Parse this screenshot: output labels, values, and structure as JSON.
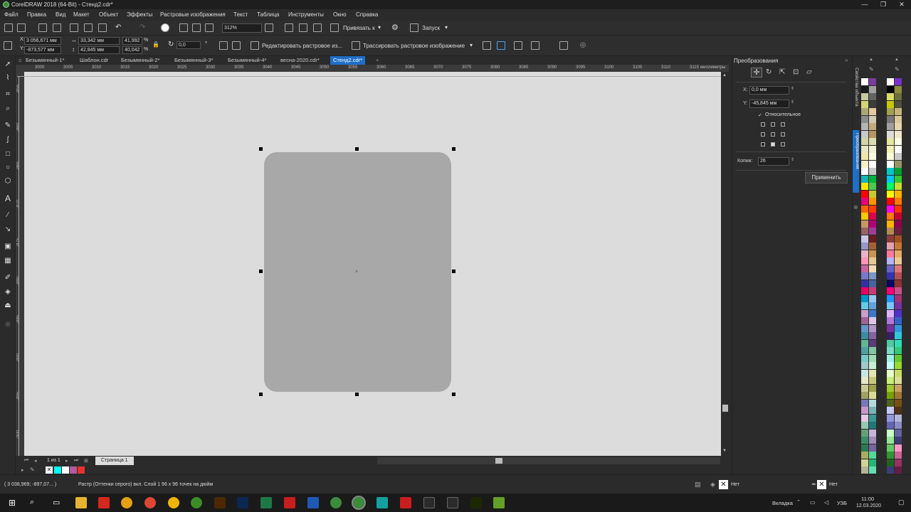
{
  "window": {
    "title": "CorelDRAW 2018 (64-Bit) - Стенд2.cdr*",
    "buttons": [
      "—",
      "❐",
      "✕"
    ]
  },
  "menu": [
    "Файл",
    "Правка",
    "Вид",
    "Макет",
    "Объект",
    "Эффекты",
    "Растровые изображения",
    "Текст",
    "Таблица",
    "Инструменты",
    "Окно",
    "Справка"
  ],
  "toolbar": {
    "zoom": "312%",
    "snap_label": "Привязать к",
    "launch_label": "Запуск"
  },
  "propbar": {
    "x": "3 056,671 мм",
    "y": "-873,577 мм",
    "width": "33,342 мм",
    "height": "42,845 мм",
    "scale_x": "41,992",
    "scale_y": "40,042",
    "pct": "%",
    "rotation": "0,0",
    "edit_bitmap": "Редактировать растровое из...",
    "trace_bitmap": "Трассировать растровое изображение"
  },
  "tabs": [
    "Безымянный-1*",
    "Шаблон.cdr",
    "Безымянный-2*",
    "Безымянный-3*",
    "Безымянный-4*",
    "весна-2020.cdr*",
    "Стенд2.cdr*"
  ],
  "active_tab": 6,
  "ruler": {
    "h_ticks": [
      "3000",
      "3005",
      "3010",
      "3015",
      "3020",
      "3025",
      "3030",
      "3035",
      "3040",
      "3045",
      "3050",
      "3055",
      "3060",
      "3065",
      "3070",
      "3075",
      "3080",
      "3085",
      "3090",
      "3095",
      "3100",
      "3105",
      "3110",
      "3115"
    ],
    "unit": "миллиметры",
    "v_ticks": [
      "-855",
      "-860",
      "-865",
      "-870",
      "-875",
      "-880",
      "-885",
      "-890",
      "-895",
      "-900"
    ]
  },
  "page_nav": {
    "counter": "1 из 1",
    "page_tab": "Страница 1"
  },
  "status": {
    "coords": "( 3 038,969; -897,07... )",
    "info": "Растр (Оттенки серого) вкл. Слой 1 96 x 96 точек на дюйм",
    "fill_none": "Нет",
    "outline_none": "Нет"
  },
  "panel": {
    "title": "Преобразования",
    "x_label": "X:",
    "x_value": "0,0 мм",
    "y_label": "Y:",
    "y_value": "-45,845 мм",
    "relative_label": "Относительное",
    "copies_label": "Копии:",
    "copies_value": "26",
    "apply_label": "Применить",
    "side_tabs": [
      "Свойства объекта",
      "Преобразования"
    ]
  },
  "taskbar": {
    "lang_label": "Вкладка",
    "layout": "УЗБ",
    "time": "11:00",
    "date": "12.03.2020"
  },
  "colors": {
    "accent": "#1e6fc8",
    "shape_fill": "#a8a8a8",
    "canvas": "#dcdcdc"
  },
  "palette_col1": [
    "#ffffff",
    "#1a1a1a",
    "#c8c8a0",
    "#d4d478",
    "#a8a878",
    "#8c8c8c",
    "#b4b4b4",
    "#c8c8c8",
    "#d4d4aa",
    "#e6e6c8",
    "#f0e6aa",
    "#f5f0c8",
    "#ffffff",
    "#14b4b4",
    "#ffe600",
    "#ff0000",
    "#e6007e",
    "#ff6400",
    "#ffc800",
    "#c89664",
    "#966464",
    "#c8c8e6",
    "#9696c8",
    "#e6b4c8",
    "#ff96b4",
    "#c864a0",
    "#7878c8",
    "#3232a0",
    "#e60064",
    "#0096c8",
    "#64c8e6",
    "#c8a0c8",
    "#a06496",
    "#6496c8",
    "#3c8ca0",
    "#64b496",
    "#50a0a0",
    "#78c8c8",
    "#a0c8c8",
    "#c8e6e6",
    "#e6e6c8",
    "#c8c896",
    "#a0a064",
    "#7878b4",
    "#c896c8",
    "#e6c8e6",
    "#96c8b4",
    "#64a078",
    "#3c8c64",
    "#2d7850",
    "#aaaa64",
    "#d2d296",
    "#b4b496"
  ],
  "palette_col2": [
    "#7a3ca0",
    "#a0a0a0",
    "#646464",
    "#3c3c3c",
    "#e6c8a0",
    "#d2c8b4",
    "#c8aa78",
    "#b49664",
    "#dcdcb4",
    "#f0f0d2",
    "#fafae6",
    "#ffffff",
    "#c8c8c8",
    "#00b43c",
    "#50c850",
    "#c8c832",
    "#ff9600",
    "#ff3c00",
    "#dc0050",
    "#b40078",
    "#a03c96",
    "#641e1e",
    "#a06432",
    "#c89650",
    "#e6c896",
    "#f0dcb4",
    "#7896c8",
    "#4664a0",
    "#c83c78",
    "#96c8f0",
    "#64a0dc",
    "#3c78c8",
    "#dcc8e6",
    "#b496c8",
    "#8264a0",
    "#5a3c78",
    "#82c8a0",
    "#a0dcb4",
    "#c8f0d2",
    "#e6e6b4",
    "#c8c87a",
    "#a0a050",
    "#dcdc96",
    "#b4dcdc",
    "#78b4b4",
    "#3c9696",
    "#1e7878",
    "#c8b4dc",
    "#a08cbe",
    "#7864a0",
    "#50dc96",
    "#28b478",
    "#64dcb4"
  ],
  "palette_col3": [
    "#ffffff",
    "#000000",
    "#dcdc64",
    "#c8c800",
    "#a0a050",
    "#787878",
    "#a0a0a0",
    "#dcdcdc",
    "#e6e6a0",
    "#f0f0b4",
    "#fafadc",
    "#ffffff",
    "#00c8c8",
    "#00c8ff",
    "#00ff64",
    "#ffff00",
    "#ff0000",
    "#ff00ff",
    "#ff7800",
    "#ffb400",
    "#b48c50",
    "#8c3c3c",
    "#e6a0b4",
    "#ff78a0",
    "#b4b4ff",
    "#6464c8",
    "#3232b4",
    "#000064",
    "#ff0078",
    "#1e96ff",
    "#78c8ff",
    "#dcb4ff",
    "#b478dc",
    "#7832a0",
    "#3c1e64",
    "#50c8a0",
    "#78dcc8",
    "#a0f0e6",
    "#c8ffff",
    "#e6ffc8",
    "#c8f078",
    "#a0c832",
    "#78a000",
    "#50641e",
    "#c8c8ff",
    "#9696dc",
    "#6464b4",
    "#c8ffc8",
    "#96e696",
    "#64c864",
    "#329632",
    "#1e641e",
    "#3c3c78"
  ],
  "palette_col4": [
    "#7832c8",
    "#8c8c3c",
    "#6e6e3c",
    "#50503c",
    "#c8b478",
    "#dcc896",
    "#e6d7aa",
    "#f0e6c8",
    "#fafae6",
    "#ffffff",
    "#c8c8c8",
    "#969664",
    "#00a032",
    "#32c832",
    "#c8dc32",
    "#ffb400",
    "#ff7800",
    "#ff3200",
    "#c80032",
    "#8c0050",
    "#6e1e3c",
    "#a0501e",
    "#c87832",
    "#e6aa64",
    "#f0c896",
    "#dc7878",
    "#b45050",
    "#8c3232",
    "#c8508c",
    "#a03278",
    "#7832a0",
    "#5032c8",
    "#3264c8",
    "#3296dc",
    "#32c8dc",
    "#32dcb4",
    "#32c878",
    "#64c832",
    "#96dc32",
    "#c8dc64",
    "#dcdc96",
    "#c8a064",
    "#a07832",
    "#785014",
    "#503214",
    "#b4b4dc",
    "#8c8cc8",
    "#6464a0",
    "#3c3c78",
    "#ff96c8",
    "#c86496",
    "#963264",
    "#641e46"
  ]
}
